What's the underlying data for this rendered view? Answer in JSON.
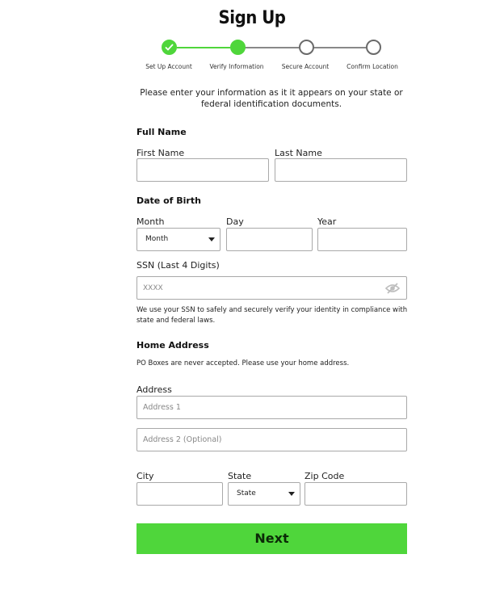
{
  "page": {
    "title": "Sign Up"
  },
  "stepper": {
    "steps": [
      {
        "label": "Set Up Account",
        "state": "done"
      },
      {
        "label": "Verify Information",
        "state": "current"
      },
      {
        "label": "Secure Account",
        "state": "pending"
      },
      {
        "label": "Confirm Location",
        "state": "pending"
      }
    ],
    "accent_color": "#4fd63b"
  },
  "intro": "Please enter your information as it it appears on your state or federal identification documents.",
  "full_name": {
    "heading": "Full Name",
    "first_label": "First Name",
    "last_label": "Last Name",
    "first_value": "",
    "last_value": ""
  },
  "dob": {
    "heading": "Date of Birth",
    "month_label": "Month",
    "month_value": "Month",
    "day_label": "Day",
    "day_value": "",
    "year_label": "Year",
    "year_value": ""
  },
  "ssn": {
    "label": "SSN (Last 4 Digits)",
    "placeholder": "XXXX",
    "note": "We use your SSN to safely and securely verify your identity in compliance with state and federal laws."
  },
  "home_address": {
    "heading": "Home Address",
    "note": "PO Boxes are never accepted. Please use your home address.",
    "address_label": "Address",
    "address1_placeholder": "Address 1",
    "address2_placeholder": "Address 2 (Optional)",
    "city_label": "City",
    "city_value": "",
    "state_label": "State",
    "state_value": "State",
    "zip_label": "Zip Code",
    "zip_value": ""
  },
  "actions": {
    "next_label": "Next"
  }
}
